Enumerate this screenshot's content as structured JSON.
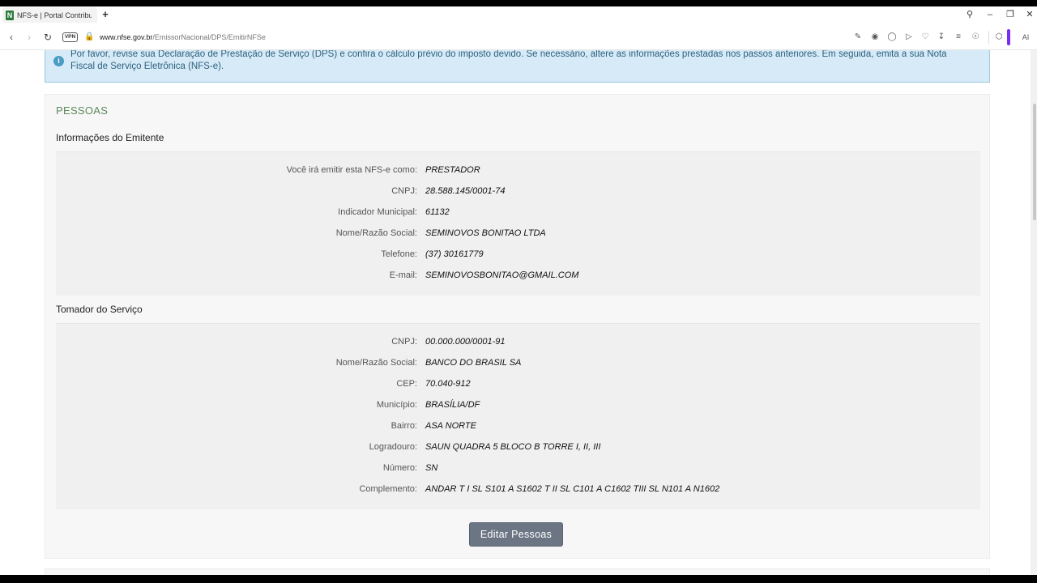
{
  "browser": {
    "tab_title": "NFS-e | Portal Contribuinte",
    "favicon_letter": "N",
    "vpn_label": "VPN",
    "url_host": "www.nfse.gov.br",
    "url_path": "/EmissorNacional/DPS/EmitirNFSe",
    "ai_label": "AI"
  },
  "alert": {
    "text": "Por favor, revise sua Declaração de Prestação de Serviço (DPS) e confira o cálculo prévio do imposto devido. Se necessário, altere as informações prestadas nos passos anteriores. Em seguida, emita a sua Nota Fiscal de Serviço Eletrônica (NFS-e)."
  },
  "section": {
    "title": "PESSOAS"
  },
  "emitente": {
    "heading": "Informações do Emitente",
    "rows": [
      {
        "label": "Você irá emitir esta NFS-e como:",
        "value": "PRESTADOR"
      },
      {
        "label": "CNPJ:",
        "value": "28.588.145/0001-74"
      },
      {
        "label": "Indicador Municipal:",
        "value": "61132"
      },
      {
        "label": "Nome/Razão Social:",
        "value": "SEMINOVOS BONITAO LTDA"
      },
      {
        "label": "Telefone:",
        "value": "(37) 30161779"
      },
      {
        "label": "E-mail:",
        "value": "SEMINOVOSBONITAO@GMAIL.COM"
      }
    ]
  },
  "tomador": {
    "heading": "Tomador do Serviço",
    "rows": [
      {
        "label": "CNPJ:",
        "value": "00.000.000/0001-91"
      },
      {
        "label": "Nome/Razão Social:",
        "value": "BANCO DO BRASIL SA"
      },
      {
        "label": "CEP:",
        "value": "70.040-912"
      },
      {
        "label": "Município:",
        "value": "BRASÍLIA/DF"
      },
      {
        "label": "Bairro:",
        "value": "ASA NORTE"
      },
      {
        "label": "Logradouro:",
        "value": "SAUN QUADRA 5 BLOCO B TORRE I, II, III"
      },
      {
        "label": "Número:",
        "value": "SN"
      },
      {
        "label": "Complemento:",
        "value": "ANDAR T I SL S101 A S1602 T II SL C101 A C1602 TIII SL N101 A N1602"
      }
    ]
  },
  "actions": {
    "edit_label": "Editar Pessoas"
  },
  "colors": {
    "section_title": "#5b8a5b",
    "alert_bg": "#d6ebf7",
    "button_bg": "#6b7584"
  }
}
